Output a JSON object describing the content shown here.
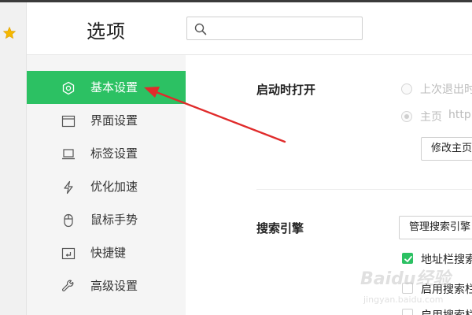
{
  "header": {
    "title": "选项",
    "search_placeholder": ""
  },
  "sidebar": {
    "items": [
      {
        "label": "基本设置",
        "icon": "hexagon-gear-icon",
        "active": true
      },
      {
        "label": "界面设置",
        "icon": "window-icon",
        "active": false
      },
      {
        "label": "标签设置",
        "icon": "laptop-icon",
        "active": false
      },
      {
        "label": "优化加速",
        "icon": "lightning-icon",
        "active": false
      },
      {
        "label": "鼠标手势",
        "icon": "mouse-icon",
        "active": false
      },
      {
        "label": "快捷键",
        "icon": "shortcut-icon",
        "active": false
      },
      {
        "label": "高级设置",
        "icon": "wrench-icon",
        "active": false
      }
    ]
  },
  "startup": {
    "title": "启动时打开",
    "option_last_session": "上次退出时",
    "option_homepage": "主页",
    "homepage_url": "http",
    "change_homepage_button": "修改主页"
  },
  "search_engine": {
    "title": "搜索引擎",
    "manage_button": "管理搜索引擎",
    "checkbox_addressbar": "地址栏搜索",
    "checkbox_enable": "启用搜索栏",
    "checkbox_enable2": "启用搜索栏"
  },
  "watermark": {
    "text": "Baidu经验",
    "sub": "jingyan.baidu.com"
  },
  "colors": {
    "accent": "#2cc163",
    "arrow": "#e02b2b"
  }
}
